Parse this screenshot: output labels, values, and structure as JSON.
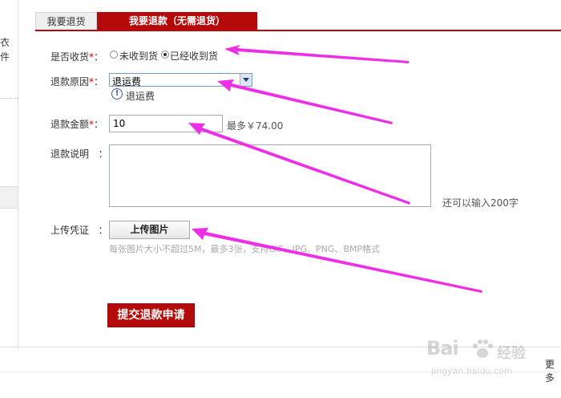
{
  "sidebar": {
    "fragment_1": "衣",
    "fragment_2": "件"
  },
  "tabs": [
    {
      "label": "我要退货",
      "active": false
    },
    {
      "label": "我要退款（无需退货）",
      "active": true
    }
  ],
  "form": {
    "received": {
      "label": "是否收货",
      "required_mark": "*",
      "colon": "：",
      "options": [
        {
          "label": "未收到货",
          "checked": false
        },
        {
          "label": "已经收到货",
          "checked": true
        }
      ]
    },
    "reason": {
      "label": "退款原因",
      "required_mark": "*",
      "colon": "：",
      "selected": "退运费",
      "info_text": "退运费"
    },
    "amount": {
      "label": "退款金额",
      "required_mark": "*",
      "colon": "：",
      "value": "10",
      "max_text": "最多￥74.00"
    },
    "description": {
      "label": "退款说明",
      "colon": "：",
      "value": "",
      "remaining_text": "还可以输入200字"
    },
    "voucher": {
      "label": "上传凭证",
      "colon": "：",
      "button_label": "上传图片",
      "hint": "每张图片大小不超过5M，最多3张，支持GIF、JPG、PNG、BMP格式"
    },
    "submit_label": "提交退款申请"
  },
  "footer": {
    "more_text": "更多"
  },
  "watermark": {
    "brand": "Bai",
    "brand_cn": "经验",
    "url": "jingyan.baidu.com"
  },
  "colors": {
    "accent": "#b40a0a",
    "arrow": "#ee2ee6"
  },
  "icons": {
    "info": "info-circle-icon",
    "dropdown": "chevron-down-icon",
    "watermark_paw": "paw-icon"
  }
}
